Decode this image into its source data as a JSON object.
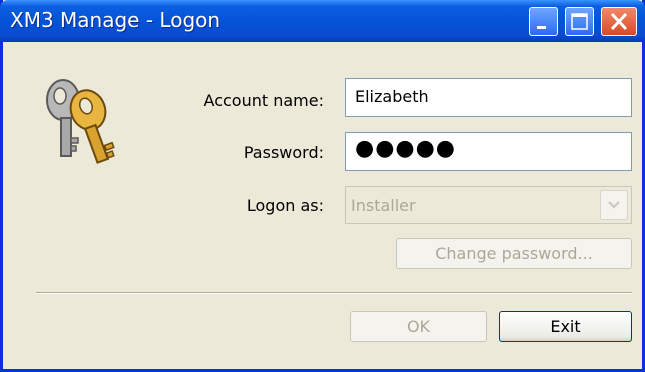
{
  "window": {
    "title": "XM3 Manage - Logon"
  },
  "form": {
    "account_label": "Account name:",
    "account_value": "Elizabeth",
    "password_label": "Password:",
    "password_value": "●●●●●",
    "logon_as_label": "Logon as:",
    "logon_as_value": "Installer"
  },
  "buttons": {
    "change_password": "Change password...",
    "ok": "OK",
    "exit": "Exit"
  },
  "icons": {
    "app": "keys-icon",
    "minimize": "minimize-icon",
    "maximize": "maximize-icon",
    "close": "close-icon",
    "dropdown": "chevron-down-icon"
  }
}
